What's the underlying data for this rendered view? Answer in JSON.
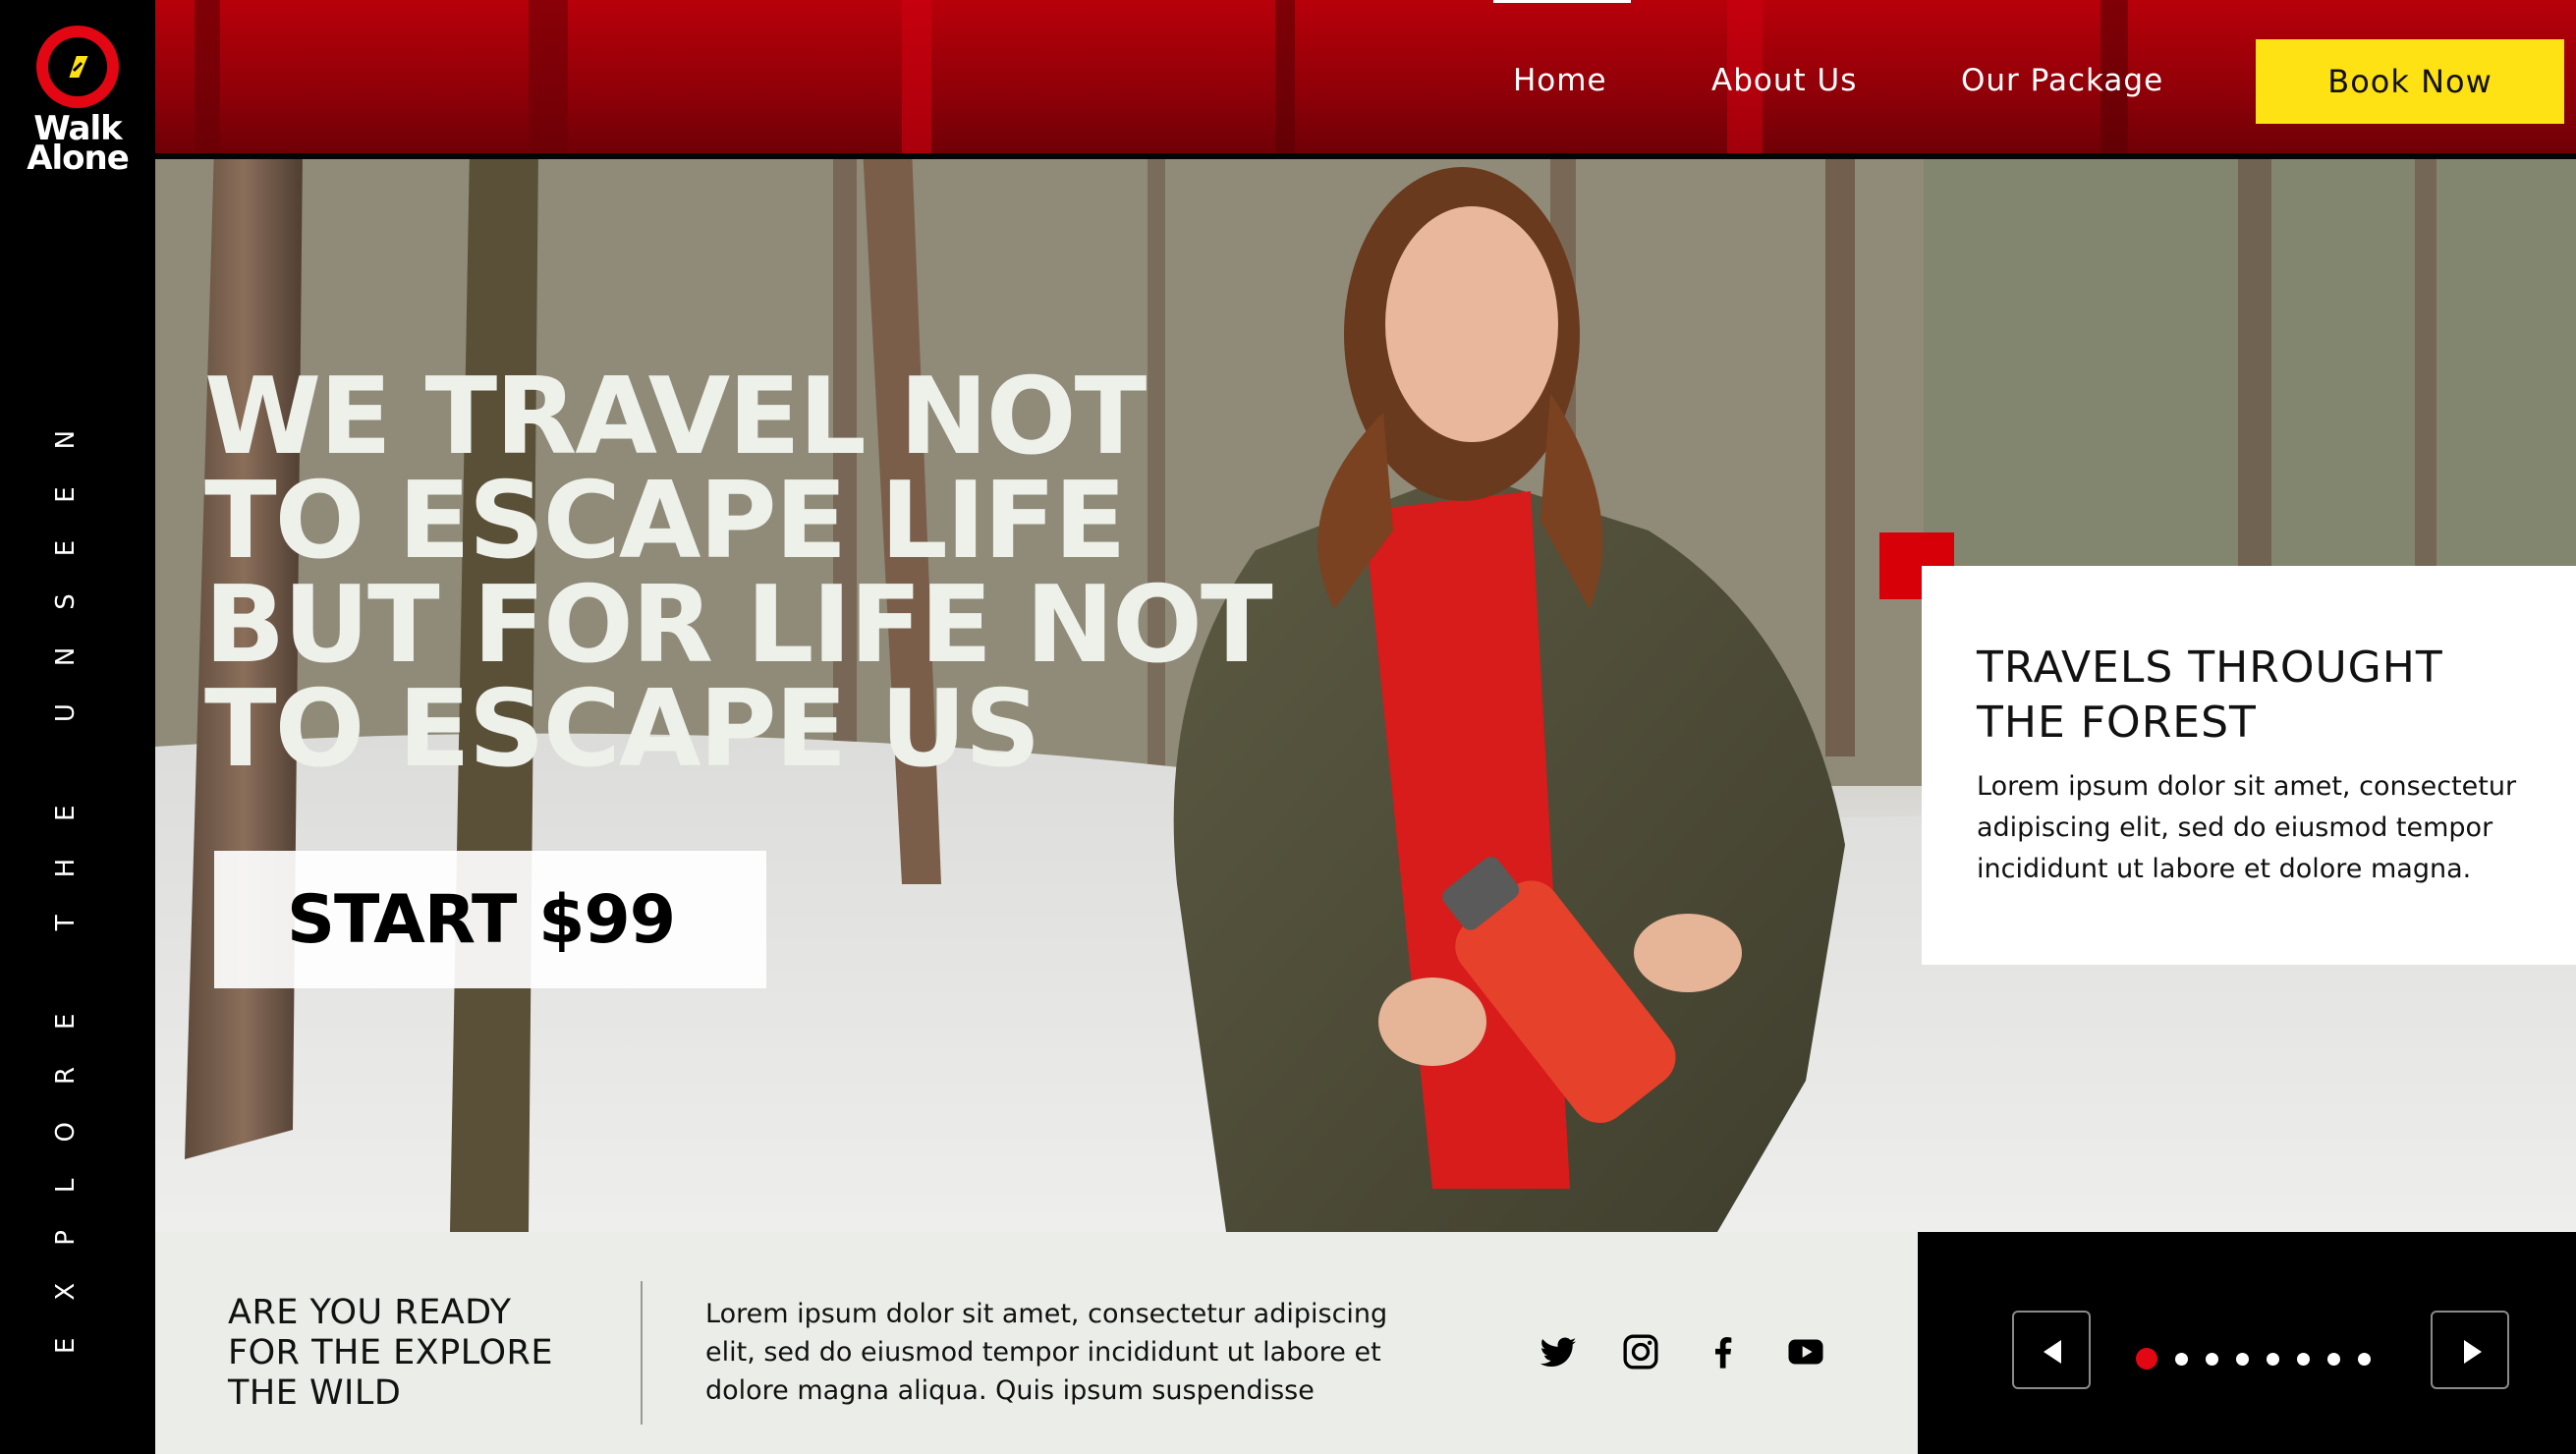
{
  "brand": {
    "name_line1": "Walk",
    "name_line2": "Alone",
    "tagline": "EXPLORE THE UNSEEN",
    "logo_icon": "compass-icon",
    "accent_color": "#e30613"
  },
  "nav": {
    "items": [
      {
        "label": "Home",
        "active": true
      },
      {
        "label": "About Us",
        "active": false
      },
      {
        "label": "Our Package",
        "active": false
      }
    ],
    "cta_label": "Book Now",
    "cta_color": "#ffe213"
  },
  "hero": {
    "headline_lines": [
      "WE TRAVEL NOT",
      "TO ESCAPE LIFE",
      "BUT FOR LIFE NOT",
      "TO ESCAPE US"
    ],
    "start_label": "START $99"
  },
  "card": {
    "title_line1": "TRAVELS THROUGHT",
    "title_line2": "THE FOREST",
    "body": "Lorem ipsum dolor sit amet, consectetur adipiscing elit, sed do eiusmod tempor incididunt ut labore et dolore magna."
  },
  "bottom": {
    "cta_line1": "ARE YOU READY",
    "cta_line2": "FOR THE EXPLORE",
    "cta_line3": "THE WILD",
    "body": "Lorem ipsum dolor sit amet, consectetur adipiscing elit, sed do eiusmod tempor incididunt ut labore et dolore magna aliqua. Quis ipsum suspendisse",
    "socials": [
      "twitter-icon",
      "instagram-icon",
      "facebook-icon",
      "youtube-icon"
    ]
  },
  "slider": {
    "total_slides": 8,
    "active_index": 0,
    "prev_icon": "triangle-left-icon",
    "next_icon": "triangle-right-icon"
  }
}
